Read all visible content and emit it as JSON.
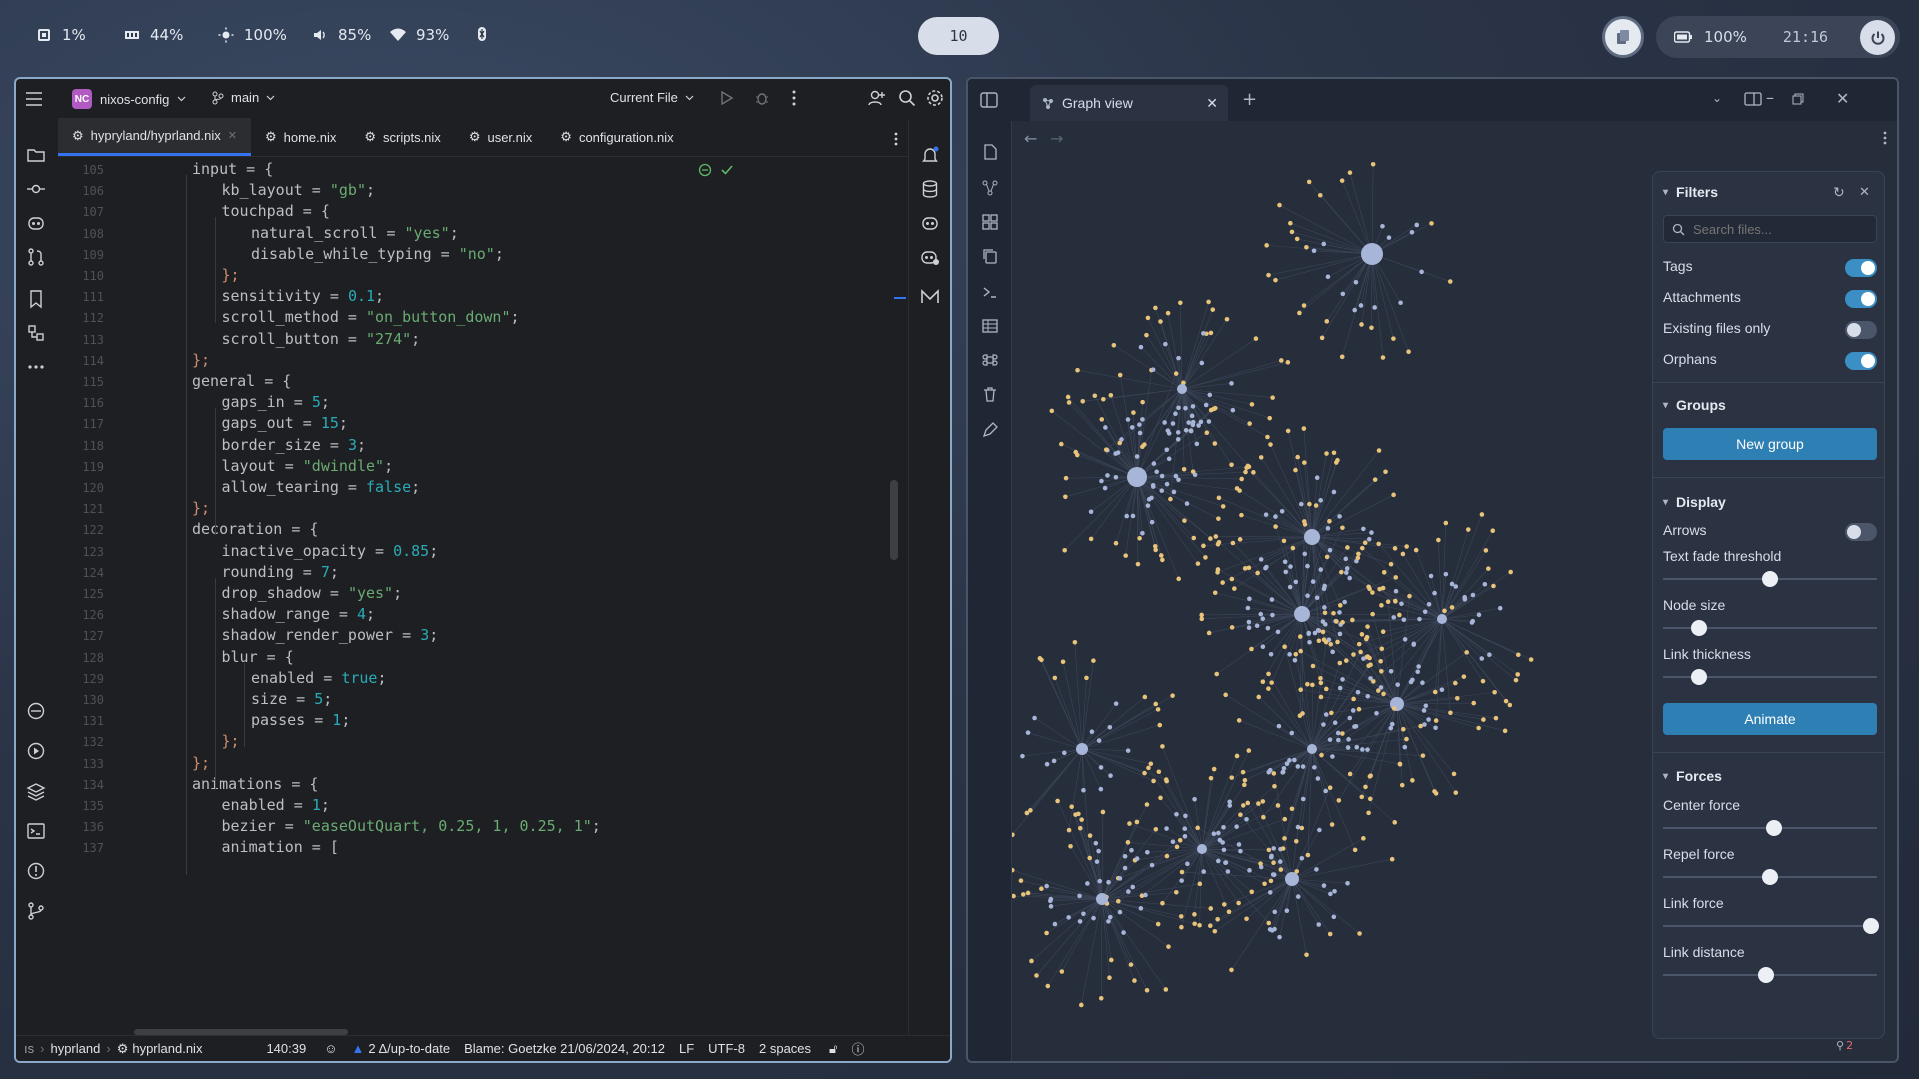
{
  "topbar": {
    "cpu": "1%",
    "memory": "44%",
    "brightness": "100%",
    "volume": "85%",
    "wifi": "93%",
    "workspace": "10",
    "battery": "100%",
    "clock": "21:16"
  },
  "ide": {
    "project_badge": "NC",
    "project": "nixos-config",
    "branch": "main",
    "run_config": "Current File",
    "tabs": [
      {
        "label": "hypryland/hyprland.nix"
      },
      {
        "label": "home.nix"
      },
      {
        "label": "scripts.nix"
      },
      {
        "label": "user.nix"
      },
      {
        "label": "configuration.nix"
      }
    ],
    "line_numbers": [
      "105",
      "106",
      "107",
      "108",
      "109",
      "110",
      "111",
      "112",
      "113",
      "114",
      "115",
      "116",
      "117",
      "118",
      "119",
      "120",
      "121",
      "122",
      "123",
      "124",
      "125",
      "126",
      "127",
      "128",
      "129",
      "130",
      "131",
      "132",
      "133",
      "134",
      "135",
      "136",
      "137"
    ],
    "code": [
      "input = {",
      "kb_layout = \"gb\";",
      "touchpad = {",
      "natural_scroll = \"yes\";",
      "disable_while_typing = \"no\";",
      "};",
      "sensitivity = 0.1;",
      "scroll_method = \"on_button_down\";",
      "scroll_button = \"274\";",
      "};",
      "general = {",
      "gaps_in = 5;",
      "gaps_out = 15;",
      "border_size = 3;",
      "layout = \"dwindle\";",
      "allow_tearing = false;",
      "};",
      "decoration = {",
      "inactive_opacity = 0.85;",
      "rounding = 7;",
      "drop_shadow = \"yes\";",
      "shadow_range = 4;",
      "shadow_render_power = 3;",
      "blur = {",
      "enabled = true;",
      "size = 5;",
      "passes = 1;",
      "};",
      "};",
      "animations = {",
      "enabled = 1;",
      "bezier = \"easeOutQuart, 0.25, 1, 0.25, 1\";",
      "animation = ["
    ],
    "status": {
      "crumb_start": "ıs",
      "crumb_dir": "hyprland",
      "crumb_file": "hyprland.nix",
      "position": "140:39",
      "vcs": "2 Δ/up-to-date",
      "blame": "Blame: Goetzke 21/06/2024, 20:12",
      "line_ending": "LF",
      "encoding": "UTF-8",
      "indent": "2 spaces"
    }
  },
  "obsidian": {
    "tab_title": "Graph view",
    "filters": {
      "title": "Filters",
      "search_placeholder": "Search files...",
      "tags": "Tags",
      "attachments": "Attachments",
      "existing": "Existing files only",
      "orphans": "Orphans",
      "tags_on": true,
      "attachments_on": true,
      "existing_on": false,
      "orphans_on": true
    },
    "groups": {
      "title": "Groups",
      "new_group": "New group"
    },
    "display": {
      "title": "Display",
      "arrows": "Arrows",
      "arrows_on": false,
      "text_fade": "Text fade threshold",
      "text_fade_value": 0.5,
      "node_size": "Node size",
      "node_size_value": 0.17,
      "link_thickness": "Link thickness",
      "link_thickness_value": 0.17,
      "animate": "Animate"
    },
    "forces": {
      "title": "Forces",
      "center": "Center force",
      "center_value": 0.52,
      "repel": "Repel force",
      "repel_value": 0.5,
      "link": "Link force",
      "link_value": 0.97,
      "distance": "Link distance",
      "distance_value": 0.48
    },
    "notification_count": "2"
  }
}
